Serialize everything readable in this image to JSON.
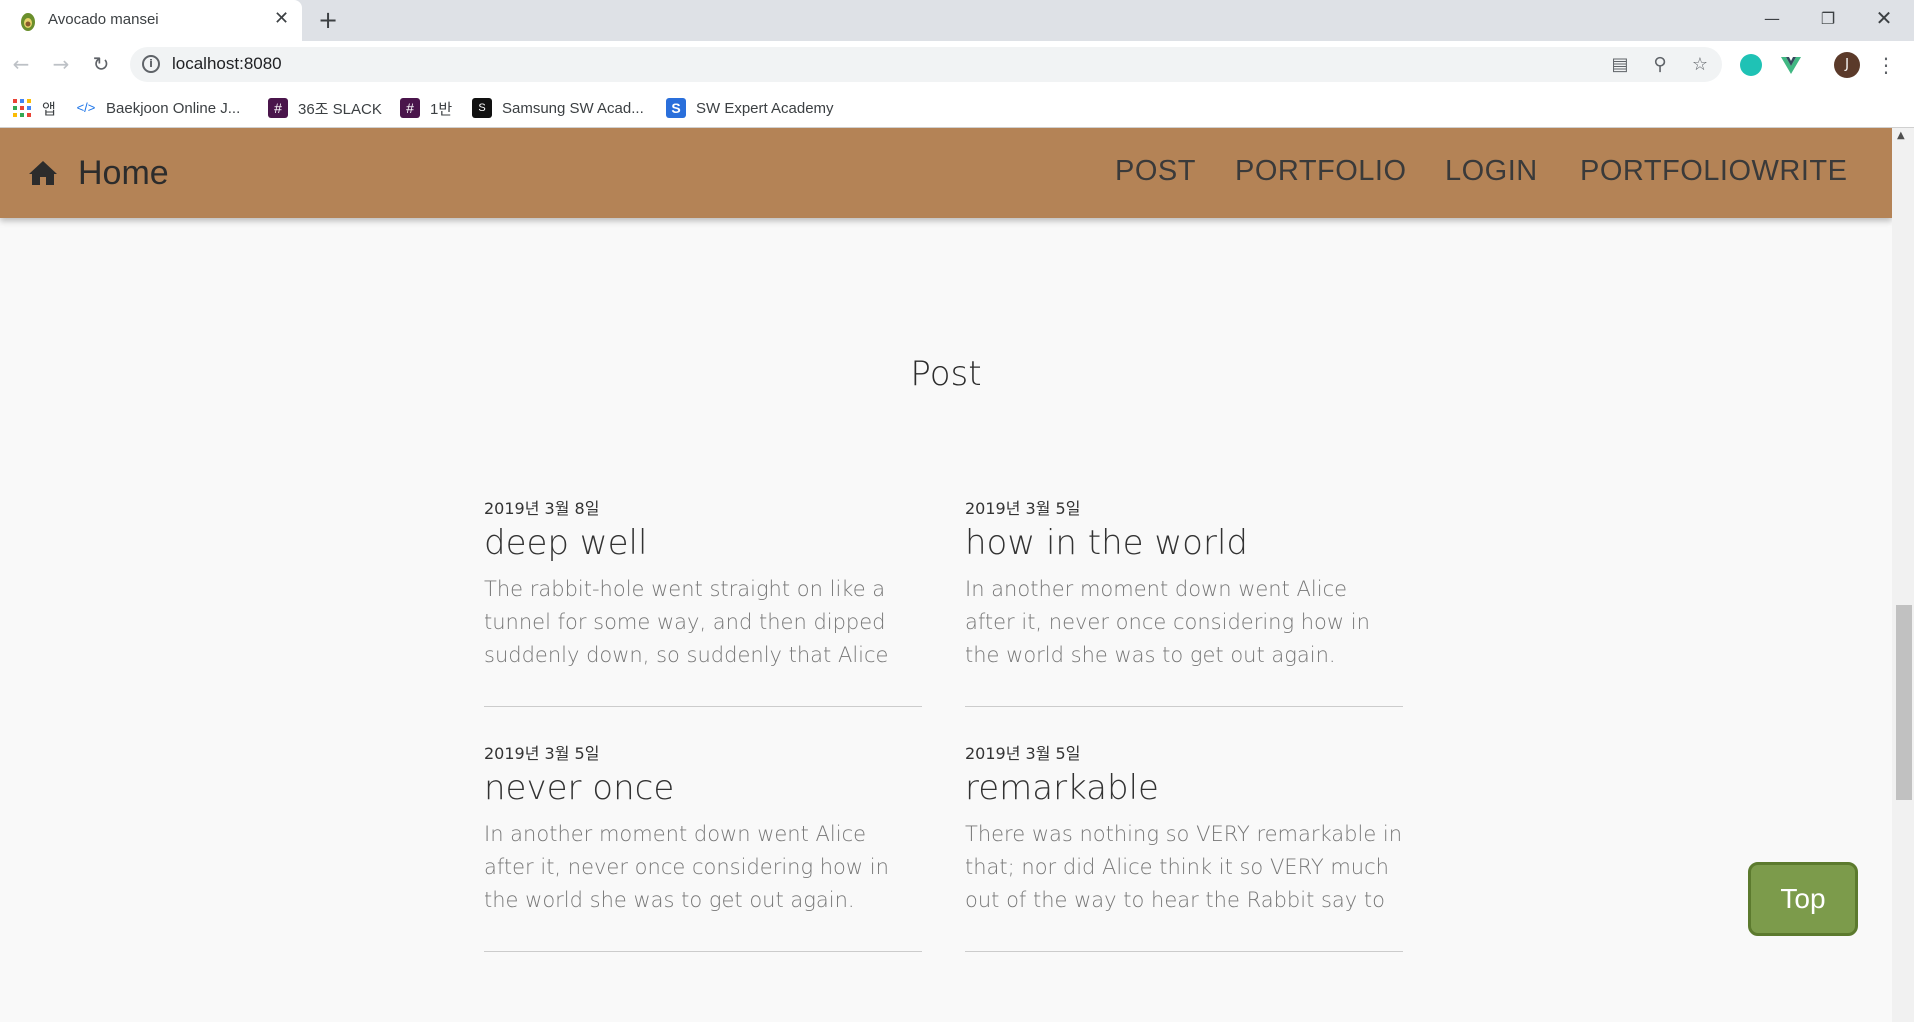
{
  "browser": {
    "tab_title": "Avocado mansei",
    "tab_close": "✕",
    "new_tab": "+",
    "url": "localhost:8080",
    "profile_initial": "J",
    "bookmarks": [
      {
        "label": "앱",
        "icon": "apps-grid-icon"
      },
      {
        "label": "Baekjoon Online J...",
        "icon": "code-icon"
      },
      {
        "label": "36조 SLACK",
        "icon": "slack-icon"
      },
      {
        "label": "1반",
        "icon": "slack-icon"
      },
      {
        "label": "Samsung SW Acad...",
        "icon": "academy-icon"
      },
      {
        "label": "SW Expert Academy",
        "icon": "swea-icon"
      }
    ]
  },
  "nav": {
    "home_label": "Home",
    "links": [
      "POST",
      "PORTFOLIO",
      "LOGIN",
      "PORTFOLIOWRITE"
    ]
  },
  "section": {
    "title": "Post"
  },
  "posts": [
    {
      "date": "2019년 3월 8일",
      "title": "deep well",
      "body": "The rabbit-hole went straight on like a tunnel for some way, and then dipped suddenly down, so suddenly that Alice had not a..."
    },
    {
      "date": "2019년 3월 5일",
      "title": "how in the world",
      "body": "In another moment down went Alice after it, never once considering how in the world she was to get out again."
    },
    {
      "date": "2019년 3월 5일",
      "title": "never once",
      "body": "In another moment down went Alice after it, never once considering how in the world she was to get out again."
    },
    {
      "date": "2019년 3월 5일",
      "title": "remarkable",
      "body": "There was nothing so VERY remarkable in that; nor did Alice think it so VERY much out of the way to hear the Rabbit say to itself"
    }
  ],
  "top_button": "Top",
  "colors": {
    "navbar": "#b48356",
    "top_button": "#7c9b4b",
    "page_bg": "#f9f9f9"
  }
}
